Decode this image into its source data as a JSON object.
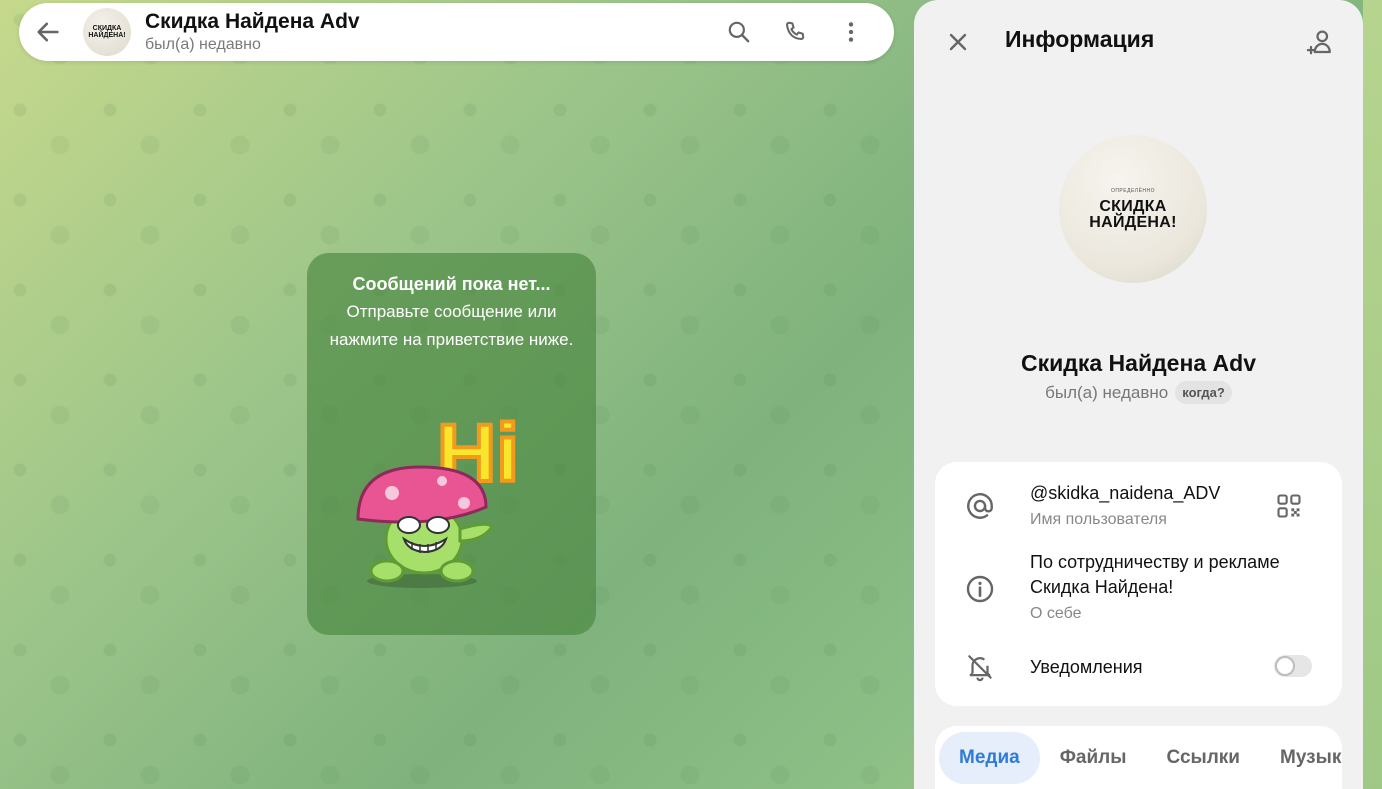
{
  "chat": {
    "title": "Скидка Найдена Adv",
    "status": "был(а) недавно",
    "empty_title": "Сообщений пока нет...",
    "empty_text": "Отправьте сообщение или нажмите на приветствие ниже."
  },
  "logo": {
    "top": "ОПРЕДЕЛЁННО",
    "line1": "СКИДКА",
    "line2": "НАЙДЕНА!"
  },
  "sticker": {
    "text": "Hi"
  },
  "info": {
    "title": "Информация",
    "name": "Скидка Найдена Adv",
    "status": "был(а) недавно",
    "when_badge": "когда?",
    "username": "@skidka_naidena_ADV",
    "username_label": "Имя пользователя",
    "bio_line1": "По сотрудничеству и рекламе",
    "bio_line2": "Скидка Найдена!",
    "bio_label": "О себе",
    "notifications_label": "Уведомления",
    "notifications_enabled": false
  },
  "tabs": [
    {
      "label": "Медиа",
      "active": true
    },
    {
      "label": "Файлы",
      "active": false
    },
    {
      "label": "Ссылки",
      "active": false
    },
    {
      "label": "Музыка",
      "active": false
    }
  ],
  "colors": {
    "accent": "#2f7bd6",
    "card_green": "#46823c"
  }
}
